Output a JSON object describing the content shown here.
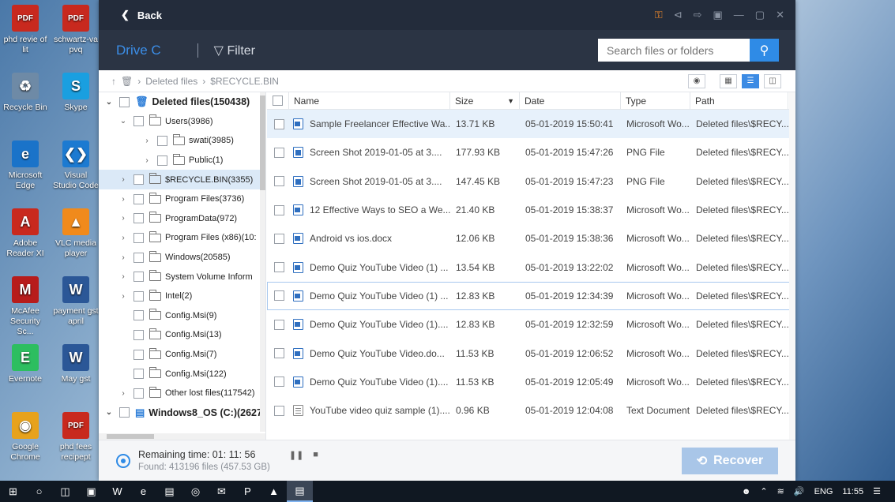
{
  "desktop": {
    "icons": [
      {
        "label": "phd revie of lit",
        "icon": "pdf-icon"
      },
      {
        "label": "schwartz-va pvq",
        "icon": "pdf-icon"
      },
      {
        "label": "Recycle Bin",
        "icon": "recycle-bin-icon"
      },
      {
        "label": "Skype",
        "icon": "skype-icon"
      },
      {
        "label": "Microsoft Edge",
        "icon": "edge-icon"
      },
      {
        "label": "Visual Studio Code",
        "icon": "vscode-icon"
      },
      {
        "label": "Adobe Reader XI",
        "icon": "adobe-reader-icon"
      },
      {
        "label": "VLC media player",
        "icon": "vlc-icon"
      },
      {
        "label": "McAfee Security Sc...",
        "icon": "mcafee-icon"
      },
      {
        "label": "payment gst april",
        "icon": "word-doc-icon"
      },
      {
        "label": "Evernote",
        "icon": "evernote-icon"
      },
      {
        "label": "May gst",
        "icon": "word-doc-icon"
      },
      {
        "label": "Google Chrome",
        "icon": "chrome-icon"
      },
      {
        "label": "phd fees recipept",
        "icon": "pdf-icon"
      }
    ]
  },
  "titlebar": {
    "back_label": "Back"
  },
  "toolbar": {
    "drive_label": "Drive C",
    "filter_label": "Filter",
    "search_placeholder": "Search files or folders"
  },
  "breadcrumb": {
    "root": "Deleted files",
    "current": "$RECYCLE.BIN"
  },
  "tree": [
    {
      "label": "Deleted files(150438)",
      "level": 0,
      "expanded": true,
      "bold": true,
      "icon": "trash-icon"
    },
    {
      "label": "Users(3986)",
      "level": 1,
      "expanded": true
    },
    {
      "label": "swati(3985)",
      "level": 2,
      "expanded": false
    },
    {
      "label": "Public(1)",
      "level": 2,
      "expanded": false
    },
    {
      "label": "$RECYCLE.BIN(3355)",
      "level": 1,
      "expanded": false,
      "selected": true
    },
    {
      "label": "Program Files(3736)",
      "level": 1,
      "expanded": false
    },
    {
      "label": "ProgramData(972)",
      "level": 1,
      "expanded": false
    },
    {
      "label": "Program Files (x86)(10:",
      "level": 1,
      "expanded": false
    },
    {
      "label": "Windows(20585)",
      "level": 1,
      "expanded": false
    },
    {
      "label": "System Volume Inform",
      "level": 1,
      "expanded": false
    },
    {
      "label": "Intel(2)",
      "level": 1,
      "expanded": false
    },
    {
      "label": "Config.Msi(9)",
      "level": 1,
      "leaf": true
    },
    {
      "label": "Config.Msi(13)",
      "level": 1,
      "leaf": true
    },
    {
      "label": "Config.Msi(7)",
      "level": 1,
      "leaf": true
    },
    {
      "label": "Config.Msi(122)",
      "level": 1,
      "leaf": true
    },
    {
      "label": "Other lost files(117542)",
      "level": 1,
      "expanded": false
    },
    {
      "label": "Windows8_OS (C:)(2627",
      "level": 0,
      "expanded": true,
      "bold": true,
      "icon": "drive-icon"
    }
  ],
  "columns": {
    "name": "Name",
    "size": "Size",
    "date": "Date",
    "type": "Type",
    "path": "Path"
  },
  "files": [
    {
      "name": "Sample Freelancer Effective Wa...",
      "size": "13.71 KB",
      "date": "05-01-2019 15:50:41",
      "type": "Microsoft Wo...",
      "path": "Deleted files\\$RECY...",
      "icon": "word"
    },
    {
      "name": "Screen Shot 2019-01-05 at 3....",
      "size": "177.93 KB",
      "date": "05-01-2019 15:47:26",
      "type": "PNG File",
      "path": "Deleted files\\$RECY...",
      "icon": "png"
    },
    {
      "name": "Screen Shot 2019-01-05 at 3....",
      "size": "147.45 KB",
      "date": "05-01-2019 15:47:23",
      "type": "PNG File",
      "path": "Deleted files\\$RECY...",
      "icon": "png"
    },
    {
      "name": "12 Effective Ways to SEO a We...",
      "size": "21.40 KB",
      "date": "05-01-2019 15:38:37",
      "type": "Microsoft Wo...",
      "path": "Deleted files\\$RECY...",
      "icon": "word"
    },
    {
      "name": "Android vs ios.docx",
      "size": "12.06 KB",
      "date": "05-01-2019 15:38:36",
      "type": "Microsoft Wo...",
      "path": "Deleted files\\$RECY...",
      "icon": "word"
    },
    {
      "name": "Demo Quiz YouTube Video (1) ...",
      "size": "13.54 KB",
      "date": "05-01-2019 13:22:02",
      "type": "Microsoft Wo...",
      "path": "Deleted files\\$RECY...",
      "icon": "word"
    },
    {
      "name": "Demo Quiz YouTube Video (1) ...",
      "size": "12.83 KB",
      "date": "05-01-2019 12:34:39",
      "type": "Microsoft Wo...",
      "path": "Deleted files\\$RECY...",
      "icon": "word"
    },
    {
      "name": "Demo Quiz YouTube Video (1)....",
      "size": "12.83 KB",
      "date": "05-01-2019 12:32:59",
      "type": "Microsoft Wo...",
      "path": "Deleted files\\$RECY...",
      "icon": "word"
    },
    {
      "name": "Demo Quiz YouTube Video.do...",
      "size": "11.53 KB",
      "date": "05-01-2019 12:06:52",
      "type": "Microsoft Wo...",
      "path": "Deleted files\\$RECY...",
      "icon": "word"
    },
    {
      "name": "Demo Quiz YouTube Video (1)....",
      "size": "11.53 KB",
      "date": "05-01-2019 12:05:49",
      "type": "Microsoft Wo...",
      "path": "Deleted files\\$RECY...",
      "icon": "word"
    },
    {
      "name": "YouTube video quiz sample (1)....",
      "size": "0.96 KB",
      "date": "05-01-2019 12:04:08",
      "type": "Text Document",
      "path": "Deleted files\\$RECY...",
      "icon": "txt"
    }
  ],
  "footer": {
    "remaining": "Remaining time: 01: 11: 56",
    "found": "Found: 413196 files (457.53 GB)",
    "recover_label": "Recover"
  },
  "taskbar": {
    "language": "ENG",
    "time": "11:55"
  },
  "colors": {
    "accent": "#2f8be6",
    "titlebar": "#232c3b",
    "toolbar": "#2b3444",
    "key": "#f0892a"
  }
}
